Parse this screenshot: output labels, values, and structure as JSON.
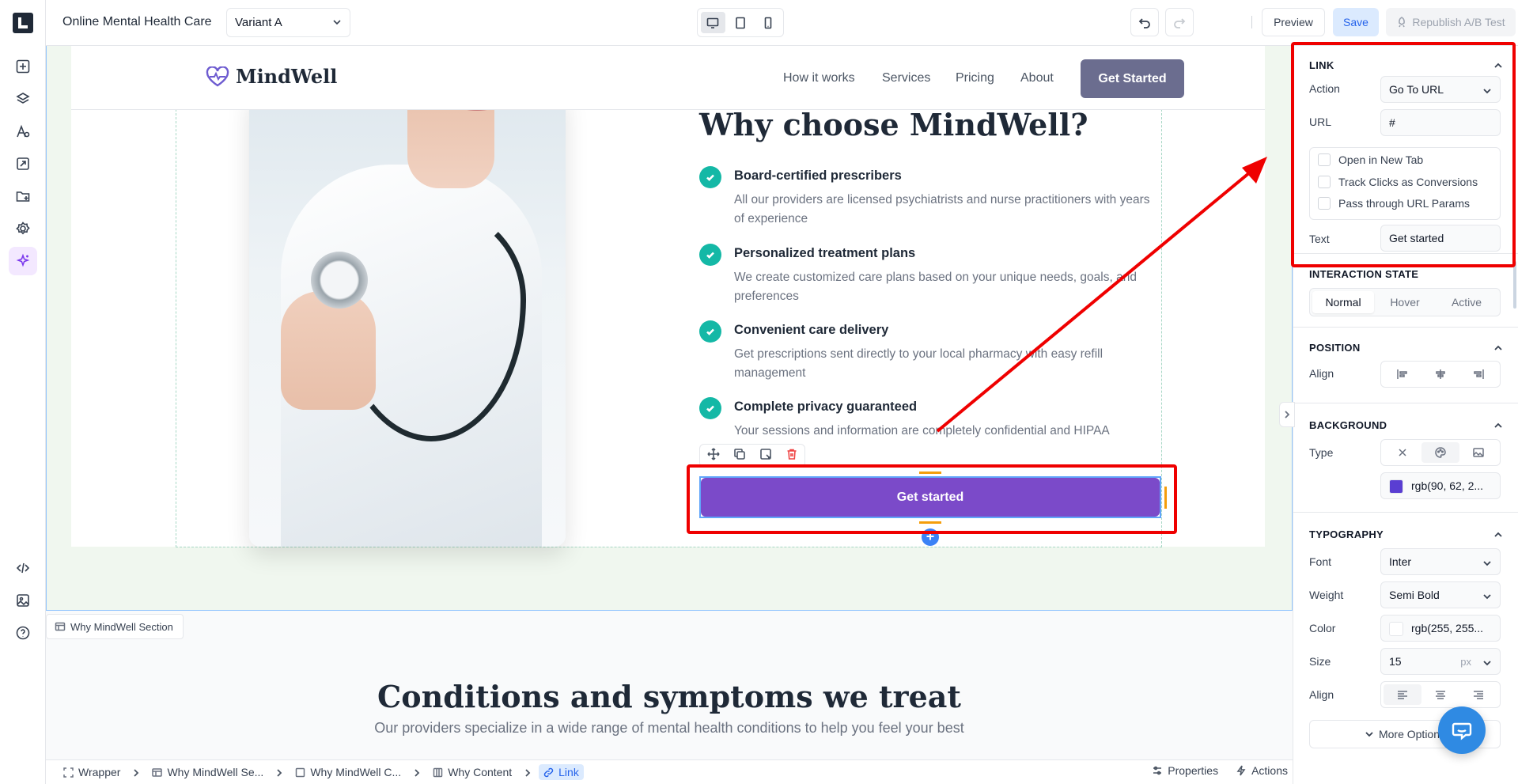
{
  "topbar": {
    "page_title": "Online Mental Health Care",
    "variant": "Variant A",
    "preview_label": "Preview",
    "save_label": "Save",
    "republish_label": "Republish A/B Test",
    "device_active": "desktop"
  },
  "site_nav": {
    "brand": "MindWell",
    "links": [
      "How it works",
      "Services",
      "Pricing",
      "About"
    ],
    "cta": "Get Started"
  },
  "why_section": {
    "title": "Why choose MindWell?",
    "features": [
      {
        "title": "Board-certified prescribers",
        "desc": "All our providers are licensed psychiatrists and nurse practitioners with years of experience"
      },
      {
        "title": "Personalized treatment plans",
        "desc": "We create customized care plans based on your unique needs, goals, and preferences"
      },
      {
        "title": "Convenient care delivery",
        "desc": "Get prescriptions sent directly to your local pharmacy with easy refill management"
      },
      {
        "title": "Complete privacy guaranteed",
        "desc": "Your sessions and information are completely confidential and HIPAA"
      }
    ],
    "cta": "Get started",
    "section_label": "Why MindWell Section"
  },
  "conditions": {
    "title": "Conditions and symptoms we treat",
    "subtitle": "Our providers specialize in a wide range of mental health conditions to help you feel your best"
  },
  "breadcrumb": {
    "items": [
      "Wrapper",
      "Why MindWell Se...",
      "Why MindWell C...",
      "Why Content",
      "Link"
    ],
    "properties_label": "Properties",
    "actions_label": "Actions"
  },
  "panel": {
    "link": {
      "heading": "LINK",
      "action_label": "Action",
      "action_value": "Go To URL",
      "url_label": "URL",
      "url_value": "#",
      "checkboxes": [
        "Open in New Tab",
        "Track Clicks as Conversions",
        "Pass through URL Params"
      ],
      "text_label": "Text",
      "text_value": "Get started"
    },
    "interaction": {
      "heading": "INTERACTION STATE",
      "states": [
        "Normal",
        "Hover",
        "Active"
      ],
      "selected": "Normal"
    },
    "position": {
      "heading": "POSITION",
      "align_label": "Align"
    },
    "background": {
      "heading": "BACKGROUND",
      "type_label": "Type",
      "color_value": "rgb(90, 62, 2...",
      "color_hex": "#5a3ed2"
    },
    "typography": {
      "heading": "TYPOGRAPHY",
      "font_label": "Font",
      "font_value": "Inter",
      "weight_label": "Weight",
      "weight_value": "Semi Bold",
      "color_label": "Color",
      "color_value": "rgb(255, 255...",
      "size_label": "Size",
      "size_value": "15",
      "size_unit": "px",
      "align_label": "Align"
    },
    "more_options": "More Options"
  },
  "colors": {
    "accent": "#7b4ac9",
    "teal_check": "#14b8a6",
    "annotation_red": "#ef0000",
    "nav_cta": "#6b6d8f"
  }
}
